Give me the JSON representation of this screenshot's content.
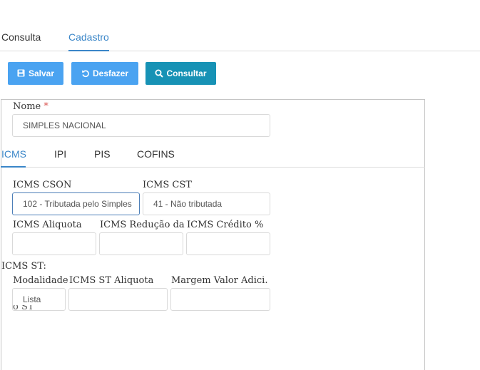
{
  "tabs": {
    "consulta": "Consulta",
    "cadastro": "Cadastro"
  },
  "toolbar": {
    "save_label": "Salvar",
    "undo_label": "Desfazer",
    "query_label": "Consultar"
  },
  "form": {
    "nome_label": "Nome",
    "required_mark": "*",
    "nome_value": "SIMPLES NACIONAL",
    "sub_tabs": [
      "ICMS",
      "IPI",
      "PIS",
      "COFINS"
    ],
    "icms_cson_label": "ICMS CSON",
    "icms_cson_value": "102 - Tributada pelo Simples",
    "icms_cst_label": "ICMS CST",
    "icms_cst_value": "41 - Não tributada",
    "icms_aliquota_label": "ICMS Aliquota",
    "icms_aliquota_value": "",
    "icms_reducao_label": "ICMS Redução da",
    "icms_reducao_value": "",
    "icms_credito_label": "ICMS Crédito %",
    "icms_credito_value": "",
    "icms_st_heading": "ICMS ST:",
    "modalidade_label": "Modalidade",
    "modalidade_value": "Lista",
    "modalidade_overflow": "o ST",
    "icms_st_aliquota_label": "ICMS ST Aliquota",
    "icms_st_aliquota_value": "",
    "margem_label": "Margem Valor Adici.",
    "margem_value": ""
  }
}
